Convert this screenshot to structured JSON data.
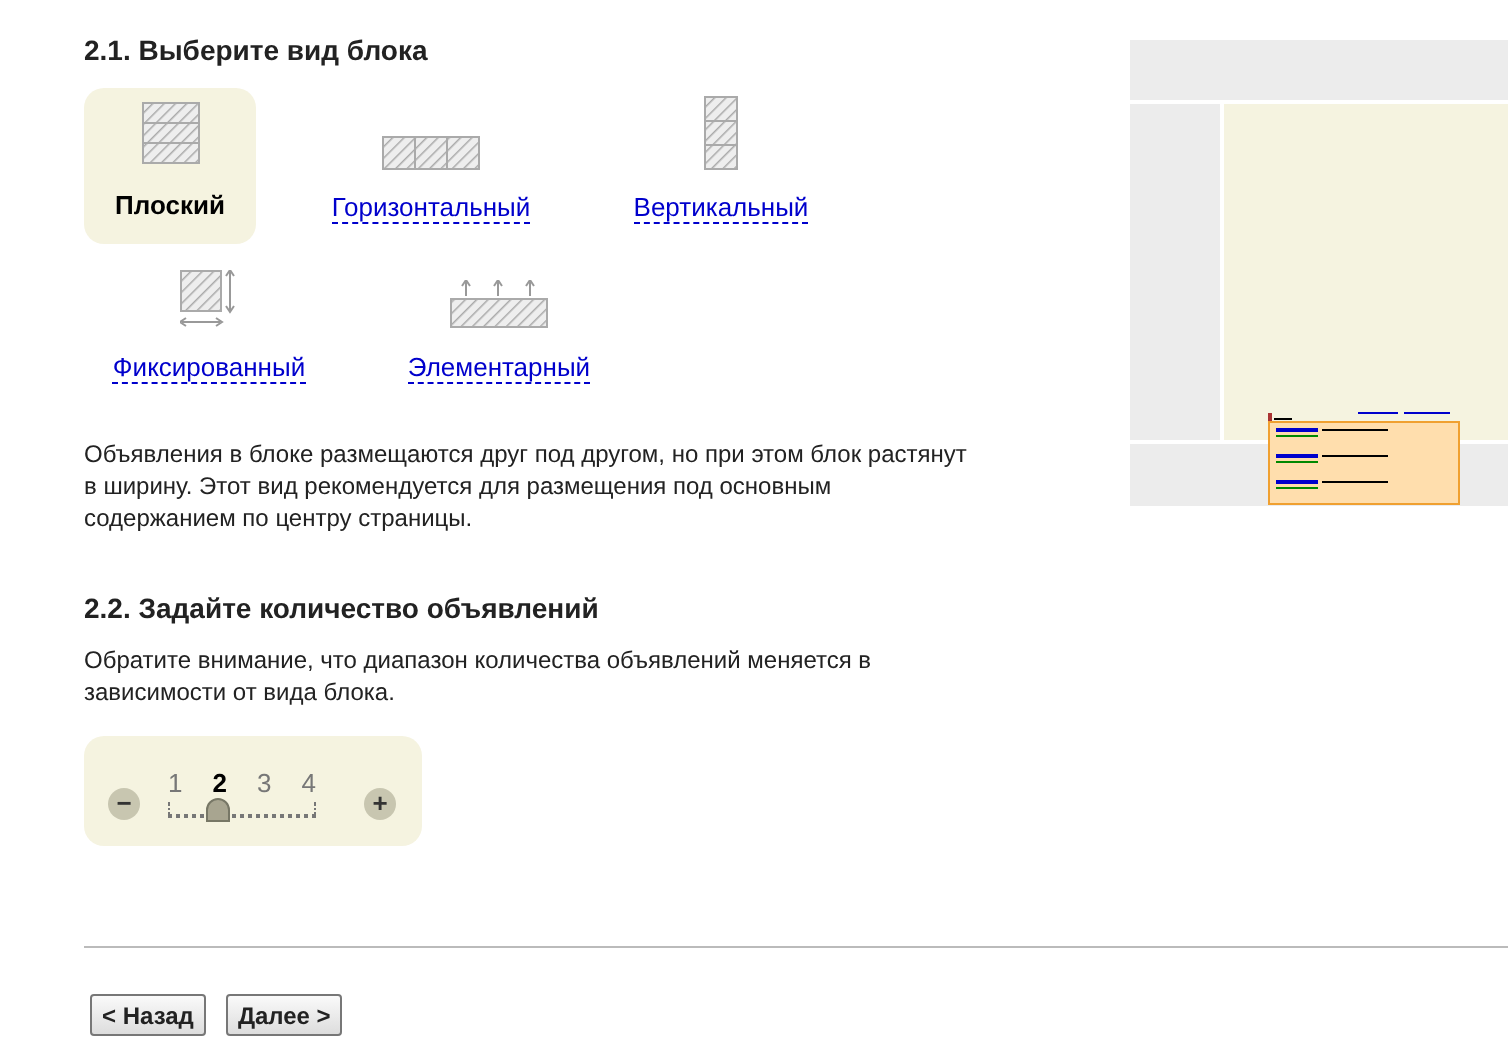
{
  "section_1": {
    "title": "2.1. Выберите вид блока",
    "block_types": [
      {
        "kind": "flat",
        "label": "Плоский",
        "selected": true
      },
      {
        "kind": "horizontal",
        "label": "Горизонтальный",
        "selected": false
      },
      {
        "kind": "vertical",
        "label": "Вертикальный",
        "selected": false
      },
      {
        "kind": "fixed",
        "label": "Фиксированный",
        "selected": false
      },
      {
        "kind": "elementary",
        "label": "Элементарный",
        "selected": false
      }
    ],
    "description": "Объявления в блоке размещаются друг под другом, но при этом блок растянут в ширину. Этот вид рекомендуется для размещения под основным содержанием по центру страницы."
  },
  "section_2": {
    "title": "2.2. Задайте количество объявлений",
    "note": "Обратите внимание, что диапазон количества объявлений меняется в зависимости от вида блока.",
    "slider": {
      "minus": "−",
      "plus": "+",
      "level": 0.3333,
      "ticks": [
        {
          "label": "1",
          "selected": false
        },
        {
          "label": "2",
          "selected": true
        },
        {
          "label": "3",
          "selected": false
        },
        {
          "label": "4",
          "selected": false
        }
      ]
    }
  },
  "buttons": [
    {
      "label": "< Назад"
    },
    {
      "label": "Далее >"
    }
  ]
}
